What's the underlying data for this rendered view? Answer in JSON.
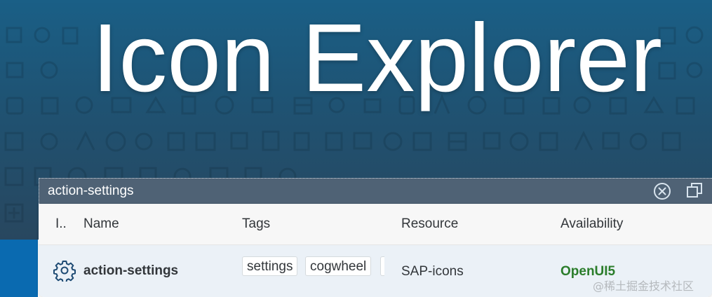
{
  "hero": {
    "title": "Icon Explorer"
  },
  "search": {
    "value": "action-settings",
    "clear_icon": "clear-circle-icon",
    "popout_icon": "popout-icon"
  },
  "table": {
    "columns": {
      "icon": "I..",
      "name": "Name",
      "tags": "Tags",
      "resource": "Resource",
      "availability": "Availability"
    },
    "rows": [
      {
        "icon": "gear-icon",
        "name": "action-settings",
        "tags": [
          "settings",
          "cogwheel"
        ],
        "resource": "SAP-icons",
        "availability": "OpenUI5"
      }
    ]
  },
  "watermark": "@稀土掘金技术社区",
  "colors": {
    "hero_top": "#1a5f86",
    "hero_bottom": "#28475f",
    "search_bar": "#4f6275",
    "row_selected": "#ebf1f7",
    "availability": "#2b7d2b"
  }
}
